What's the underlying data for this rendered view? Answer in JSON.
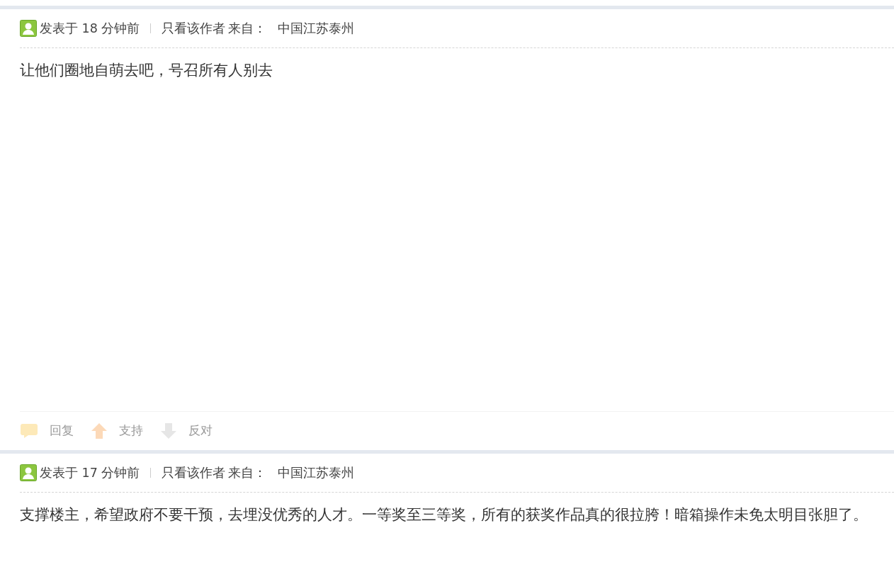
{
  "posts": [
    {
      "posted": "发表于 18 分钟前",
      "author_only": "只看该作者",
      "from_label": "来自：",
      "location": "中国江苏泰州",
      "body": "让他们圈地自萌去吧，号召所有人别去",
      "actions": [
        {
          "kind": "reply",
          "label": "回复"
        },
        {
          "kind": "up",
          "label": "支持"
        },
        {
          "kind": "down",
          "label": "反对"
        }
      ]
    },
    {
      "posted": "发表于 17 分钟前",
      "author_only": "只看该作者",
      "from_label": "来自：",
      "location": "中国江苏泰州",
      "body": "支撑楼主，希望政府不要干预，去埋没优秀的人才。一等奖至三等奖，所有的获奖作品真的很拉胯！暗箱操作未免太明目张胆了。"
    }
  ]
}
